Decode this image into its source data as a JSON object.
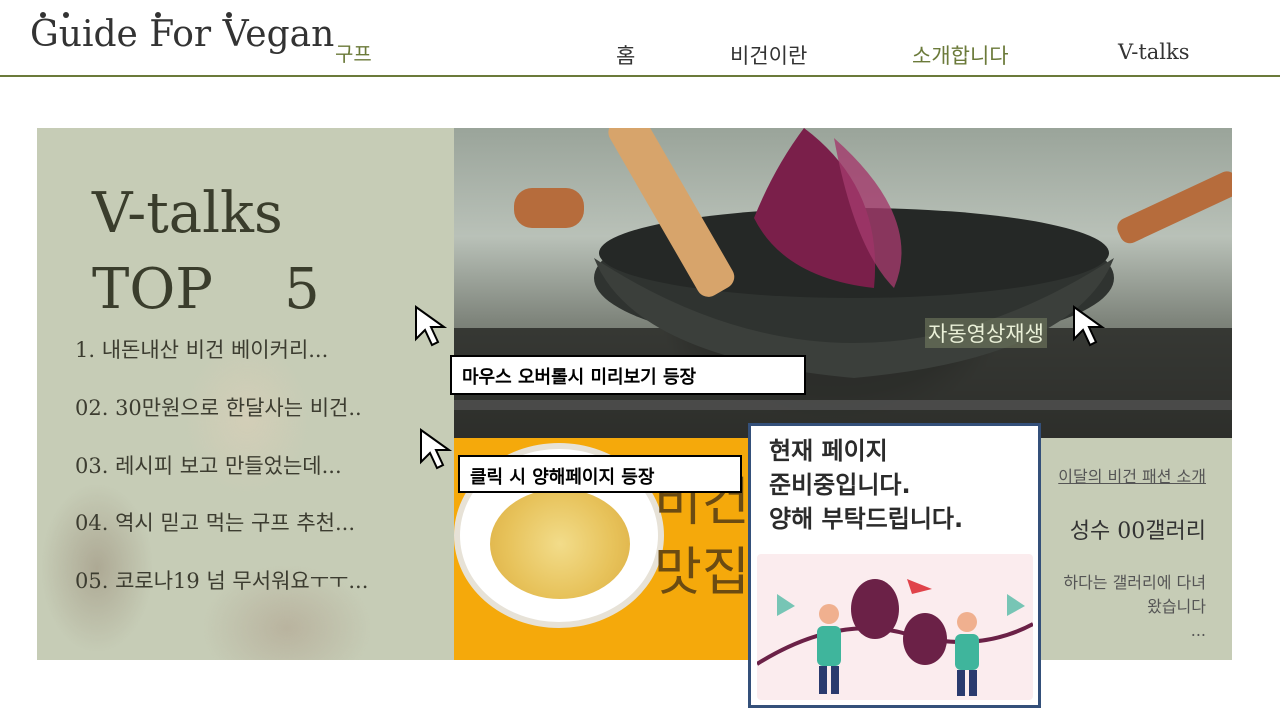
{
  "header": {
    "logo_text": "Guide For Vegan",
    "logo_sub": "구프",
    "nav": [
      {
        "label": "홈"
      },
      {
        "label": "비건이란"
      },
      {
        "label": "소개합니다"
      },
      {
        "label": "V-talks"
      }
    ]
  },
  "vtalks": {
    "title_line1": "V-talks",
    "title_line2": "TOP    5",
    "items": [
      "1.   내돈내산 비건 베이커리...",
      "02. 30만원으로 한달사는 비건..",
      "03. 레시피 보고 만들었는데...",
      "04. 역시 믿고 먹는 구프 추천...",
      "05. 코로나19 넘 무서워요ㅜㅜ..."
    ]
  },
  "hero": {
    "autoplay_label": "자동영상재생"
  },
  "featured": {
    "text": "비건\n맛집"
  },
  "side_card": {
    "link": "이달의 비건 패션 소개",
    "title": "성수 00갤러리",
    "desc": "하다는 갤러리에 다녀\n왔습니다\n..."
  },
  "annotations": {
    "hover_note": "마우스 오버롤시 미리보기 등장",
    "click_note": "클릭 시 양해페이지 등장"
  },
  "popup": {
    "message": "현재 페이지\n준비중입니다.\n양해 부탁드립니다."
  },
  "colors": {
    "brand_green": "#6b7a3a",
    "panel_sage": "#c6ccb6",
    "accent_yellow": "#f5a90b",
    "popup_border": "#34507a"
  }
}
